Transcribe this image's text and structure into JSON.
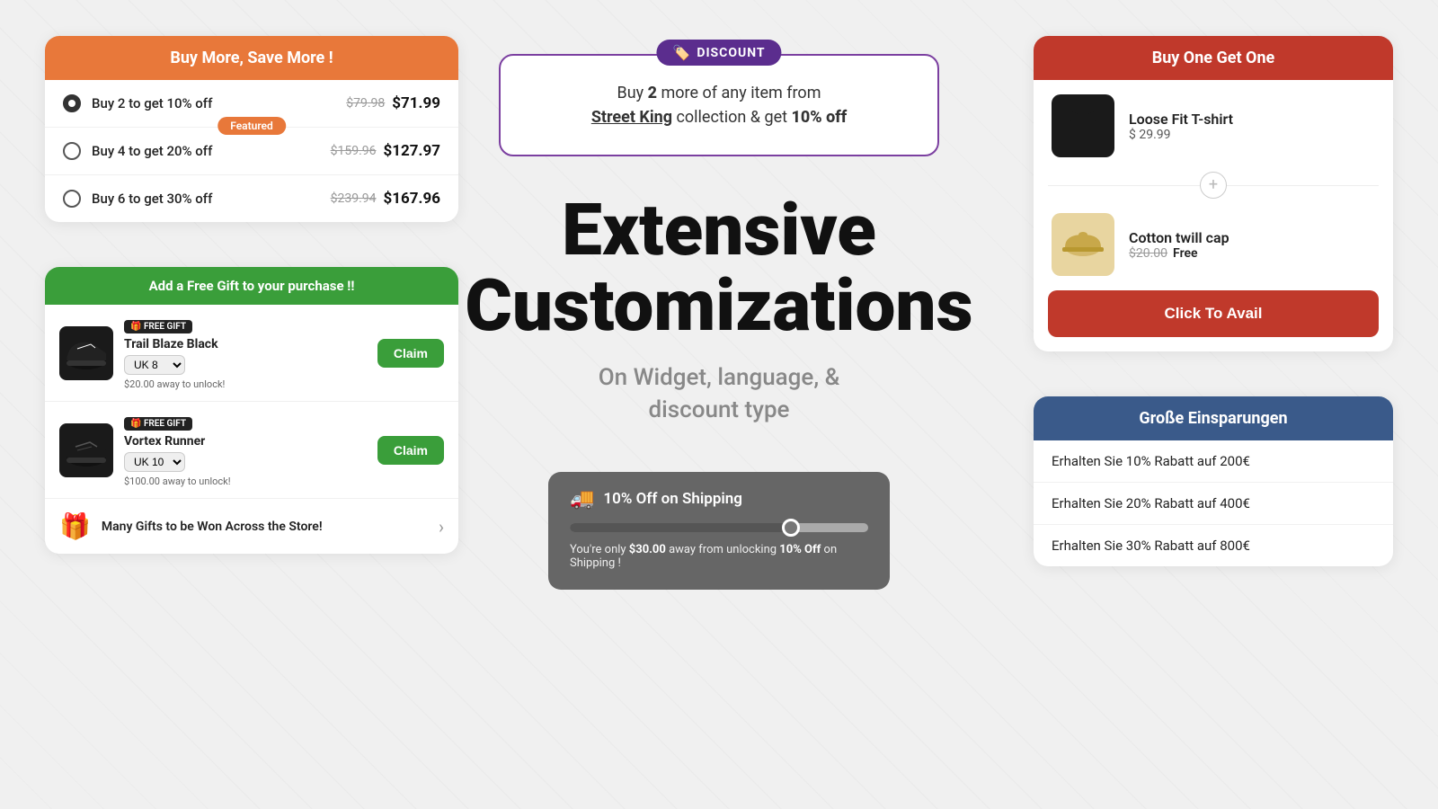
{
  "page": {
    "background_color": "#f0f0f0"
  },
  "buy_more_widget": {
    "header": "Buy More, Save More !",
    "header_color": "#e8783a",
    "rows": [
      {
        "label": "Buy 2 to get 10% off",
        "original_price": "$79.98",
        "discounted_price": "$71.99",
        "selected": true,
        "featured": false
      },
      {
        "label": "Buy 4 to get 20% off",
        "original_price": "$159.96",
        "discounted_price": "$127.97",
        "selected": false,
        "featured": true,
        "featured_label": "Featured"
      },
      {
        "label": "Buy 6 to get 30% off",
        "original_price": "$239.94",
        "discounted_price": "$167.96",
        "selected": false,
        "featured": false
      }
    ]
  },
  "free_gift_widget": {
    "header": "Add a Free Gift to your purchase !!",
    "header_color": "#3a9e3a",
    "items": [
      {
        "tag": "FREE GIFT",
        "name": "Trail Blaze Black",
        "size": "UK 8",
        "unlock_text": "$20.00 away to unlock!",
        "claim_label": "Claim"
      },
      {
        "tag": "FREE GIFT",
        "name": "Vortex Runner",
        "size": "UK 10",
        "unlock_text": "$100.00 away to unlock!",
        "claim_label": "Claim"
      }
    ],
    "footer_text": "Many Gifts to be Won Across the Store!"
  },
  "discount_widget": {
    "badge_label": "DISCOUNT",
    "text_prefix": "Buy ",
    "quantity": "2",
    "text_middle": " more of any item from",
    "collection_name": "Street King",
    "text_suffix": " collection & get ",
    "discount": "10% off"
  },
  "main_heading": "Extensive Customizations",
  "sub_heading": "On Widget, language, &\ndiscount type",
  "shipping_widget": {
    "icon": "🚚",
    "title": "10% Off on Shipping",
    "progress_percent": 75,
    "desc_prefix": "You're only ",
    "amount": "$30.00",
    "desc_middle": " away from unlocking ",
    "discount": "10% Off",
    "desc_suffix": " on Shipping !"
  },
  "bogo_widget": {
    "header": "Buy One Get One",
    "header_color": "#c0392b",
    "item1": {
      "name": "Loose Fit T-shirt",
      "price": "$ 29.99"
    },
    "item2": {
      "name": "Cotton twill cap",
      "original_price": "$20.00",
      "free_label": "Free"
    },
    "cta_label": "Click To Avail",
    "cta_color": "#c0392b"
  },
  "german_widget": {
    "header": "Große Einsparungen",
    "header_color": "#3a5a8a",
    "rows": [
      "Erhalten Sie 10% Rabatt auf 200€",
      "Erhalten Sie 20% Rabatt auf 400€",
      "Erhalten Sie 30% Rabatt auf 800€"
    ]
  }
}
